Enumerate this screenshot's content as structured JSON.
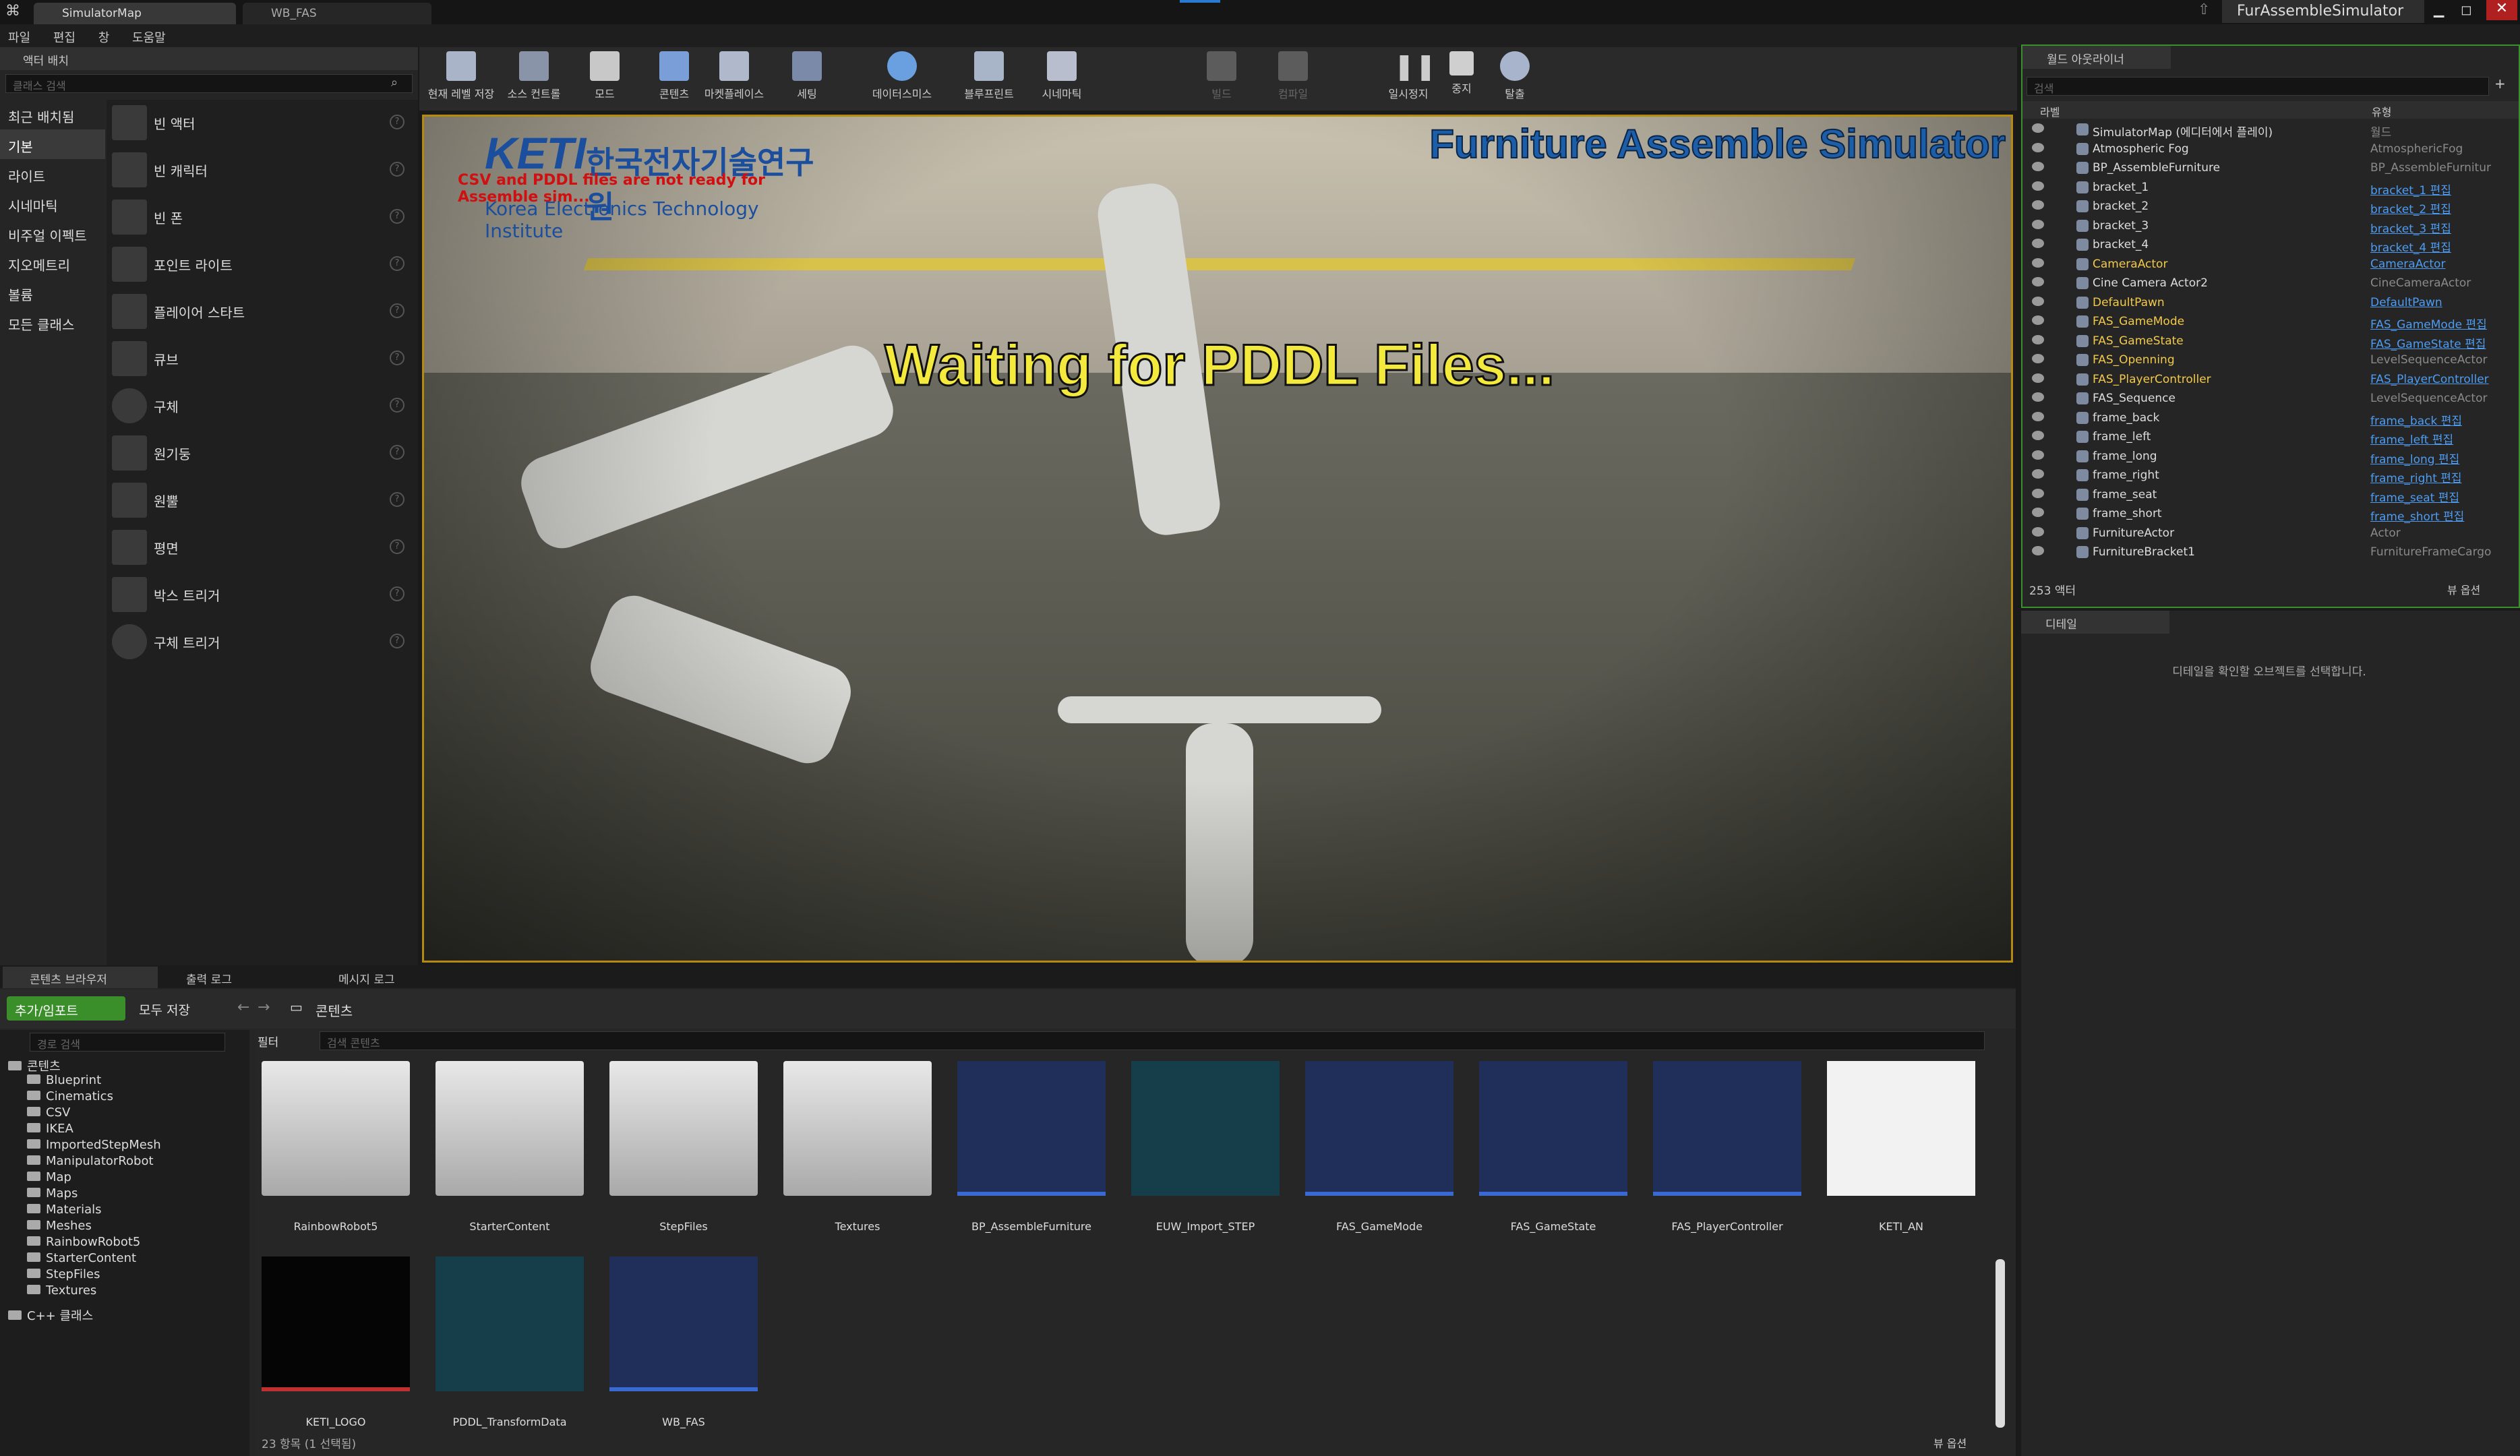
{
  "title_tabs": [
    "SimulatorMap",
    "WB_FAS"
  ],
  "window_title": "FurAssembleSimulator",
  "menu": [
    "파일",
    "편집",
    "창",
    "도움말"
  ],
  "place": {
    "tab": "액터 배치",
    "search_placeholder": "클래스 검색",
    "categories": [
      "최근 배치됨",
      "기본",
      "라이트",
      "시네마틱",
      "비주얼 이펙트",
      "지오메트리",
      "볼륨",
      "모든 클래스"
    ],
    "items": [
      "빈 액터",
      "빈 캐릭터",
      "빈 폰",
      "포인트 라이트",
      "플레이어 스타트",
      "큐브",
      "구체",
      "원기둥",
      "원뿔",
      "평면",
      "박스 트리거",
      "구체 트리거"
    ]
  },
  "toolbar": [
    "현재 레벨 저장",
    "소스 컨트롤",
    "모드",
    "콘텐츠",
    "마켓플레이스",
    "세팅",
    "데이터스미스",
    "블루프린트",
    "시네마틱",
    "빌드",
    "컴파일",
    "일시정지",
    "중지",
    "탈출"
  ],
  "viewport": {
    "overlay_title": "Furniture Assemble Simulator",
    "waiting": "Waiting for PDDL Files...",
    "csv_msg": "CSV and PDDL files are not ready for Assemble sim...",
    "logo_keti": "KETI",
    "logo_kr": "한국전자기술연구원",
    "logo_en": "Korea Electronics Technology Institute"
  },
  "outliner": {
    "tab": "월드 아웃라이너",
    "search_placeholder": "검색",
    "col_label": "라벨",
    "col_type": "유형",
    "rows": [
      {
        "n": "SimulatorMap (에디터에서 플레이)",
        "t": "월드"
      },
      {
        "n": "Atmospheric Fog",
        "t": "AtmosphericFog"
      },
      {
        "n": "BP_AssembleFurniture",
        "t": "BP_AssembleFurnitur"
      },
      {
        "n": "bracket_1",
        "t": "bracket_1 편집"
      },
      {
        "n": "bracket_2",
        "t": "bracket_2 편집"
      },
      {
        "n": "bracket_3",
        "t": "bracket_3 편집"
      },
      {
        "n": "bracket_4",
        "t": "bracket_4 편집"
      },
      {
        "n": "CameraActor",
        "t": "CameraActor"
      },
      {
        "n": "Cine Camera Actor2",
        "t": "CineCameraActor"
      },
      {
        "n": "DefaultPawn",
        "t": "DefaultPawn"
      },
      {
        "n": "FAS_GameMode",
        "t": "FAS_GameMode 편집"
      },
      {
        "n": "FAS_GameState",
        "t": "FAS_GameState 편집"
      },
      {
        "n": "FAS_Openning",
        "t": "LevelSequenceActor"
      },
      {
        "n": "FAS_PlayerController",
        "t": "FAS_PlayerController"
      },
      {
        "n": "FAS_Sequence",
        "t": "LevelSequenceActor"
      },
      {
        "n": "frame_back",
        "t": "frame_back 편집"
      },
      {
        "n": "frame_left",
        "t": "frame_left 편집"
      },
      {
        "n": "frame_long",
        "t": "frame_long 편집"
      },
      {
        "n": "frame_right",
        "t": "frame_right 편집"
      },
      {
        "n": "frame_seat",
        "t": "frame_seat 편집"
      },
      {
        "n": "frame_short",
        "t": "frame_short 편집"
      },
      {
        "n": "FurnitureActor",
        "t": "Actor"
      },
      {
        "n": "FurnitureBracket1",
        "t": "FurnitureFrameCargo"
      }
    ],
    "count": "253 액터",
    "view_options": "뷰 옵션"
  },
  "details": {
    "tab": "디테일",
    "hint": "디테일을 확인할 오브젝트를 선택합니다."
  },
  "cb": {
    "tabs": [
      "콘텐츠 브라우저",
      "출력 로그",
      "메시지 로그"
    ],
    "add_import": "추가/임포트",
    "save_all": "모두 저장",
    "path": "콘텐츠",
    "path_search": "경로 검색",
    "filters": "필터",
    "asset_search": "검색 콘텐츠",
    "folders": [
      "콘텐츠",
      "Blueprint",
      "Cinematics",
      "CSV",
      "IKEA",
      "ImportedStepMesh",
      "ManipulatorRobot",
      "Map",
      "Maps",
      "Materials",
      "Meshes",
      "RainbowRobot5",
      "StarterContent",
      "StepFiles",
      "Textures",
      "C++ 클래스"
    ],
    "assets": [
      "RainbowRobot5",
      "StarterContent",
      "StepFiles",
      "Textures",
      "BP_AssembleFurniture",
      "EUW_Import_STEP",
      "FAS_GameMode",
      "FAS_GameState",
      "FAS_PlayerController",
      "KETI_AN",
      "KETI_LOGO",
      "PDDL_TransformData",
      "WB_FAS"
    ],
    "status": "23 항목 (1 선택됨)",
    "view_options": "뷰 옵션"
  }
}
